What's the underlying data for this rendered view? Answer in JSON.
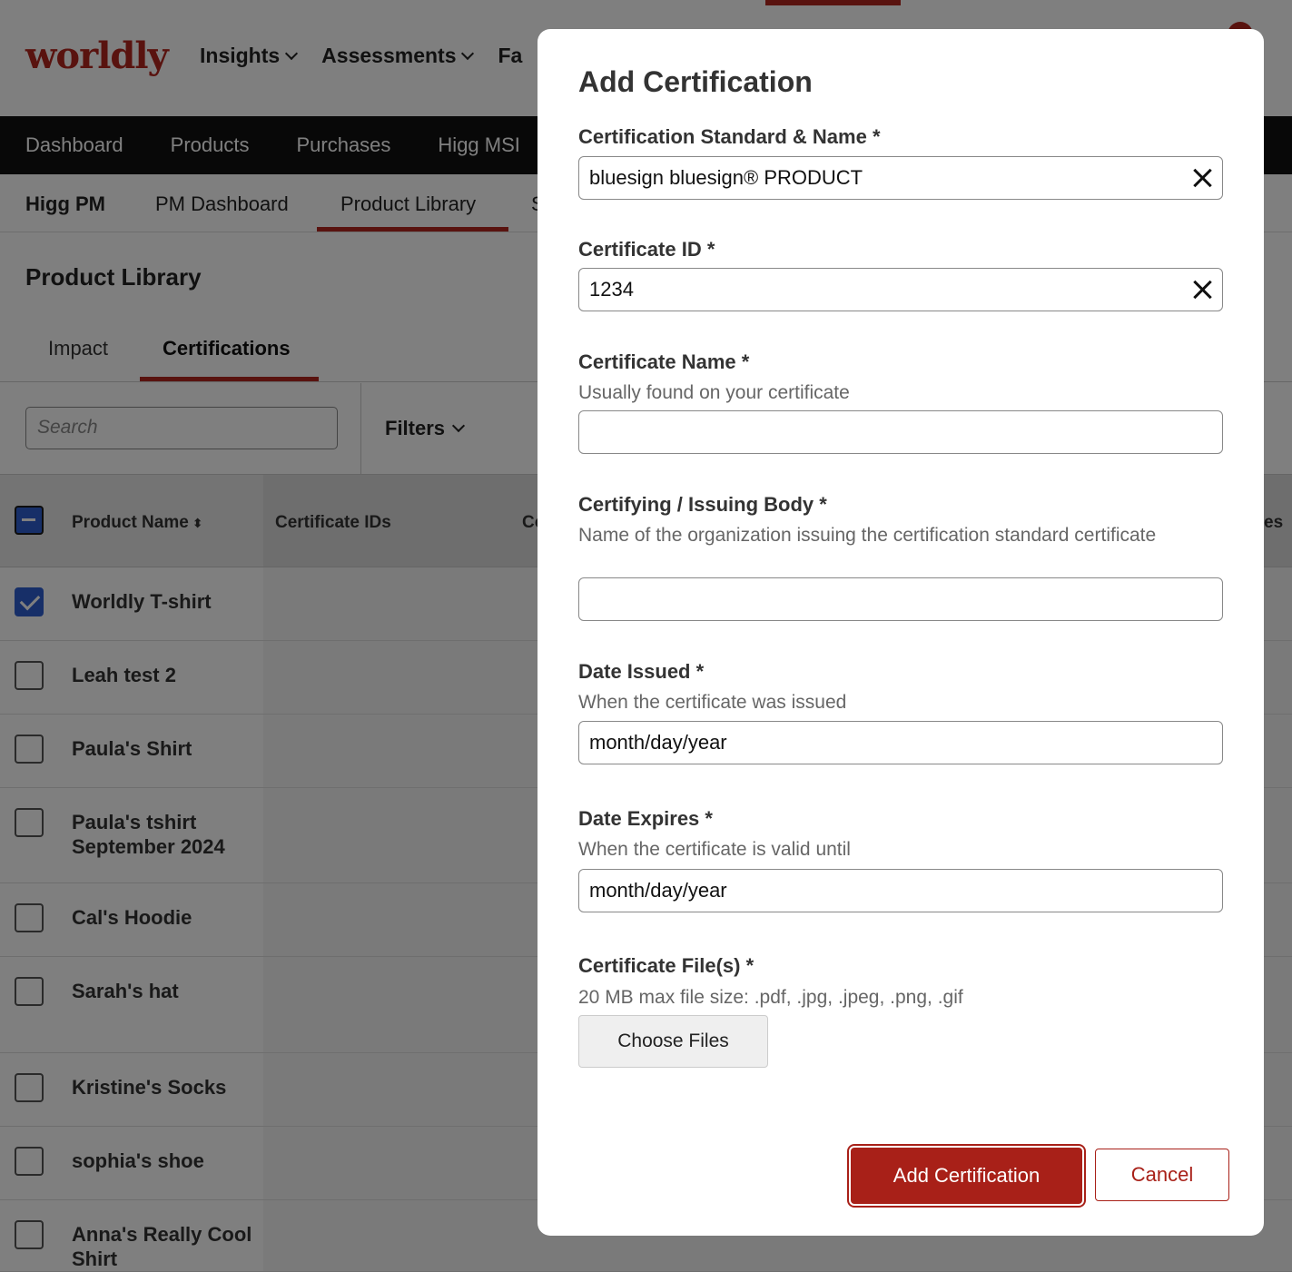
{
  "app": {
    "logo": "worldly",
    "top_nav": [
      "Insights",
      "Assessments",
      "Fa"
    ],
    "main_nav": [
      "Dashboard",
      "Products",
      "Purchases",
      "Higg MSI"
    ],
    "sub_nav": {
      "title": "Higg PM",
      "items": [
        "PM Dashboard",
        "Product Library",
        "S"
      ]
    },
    "page_title": "Product Library",
    "tabs": [
      "Impact",
      "Certifications"
    ],
    "search_placeholder": "Search",
    "filters_label": "Filters",
    "table": {
      "columns": [
        "Product Name",
        "Certificate IDs",
        "Co",
        "es"
      ],
      "rows": [
        {
          "name": "Worldly T-shirt",
          "checked": true
        },
        {
          "name": "Leah test 2",
          "checked": false
        },
        {
          "name": "Paula's Shirt",
          "checked": false
        },
        {
          "name": "Paula's tshirt September 2024",
          "checked": false
        },
        {
          "name": "Cal's Hoodie",
          "checked": false
        },
        {
          "name": "Sarah's hat",
          "checked": false
        },
        {
          "name": "Kristine's Socks",
          "checked": false
        },
        {
          "name": "sophia's shoe",
          "checked": false
        },
        {
          "name": "Anna's Really Cool Shirt",
          "checked": false
        }
      ]
    }
  },
  "modal": {
    "title": "Add Certification",
    "fields": {
      "standard": {
        "label": "Certification Standard & Name *",
        "value": "bluesign bluesign® PRODUCT"
      },
      "cert_id": {
        "label": "Certificate ID *",
        "value": "1234"
      },
      "cert_name": {
        "label": "Certificate Name *",
        "help": "Usually found on your certificate",
        "value": ""
      },
      "issuing_body": {
        "label": "Certifying / Issuing Body *",
        "help": "Name of the organization issuing the certification standard certificate",
        "value": ""
      },
      "date_issued": {
        "label": "Date Issued *",
        "help": "When the certificate was issued",
        "placeholder": "month/day/year"
      },
      "date_expires": {
        "label": "Date Expires *",
        "help": "When the certificate is valid until",
        "placeholder": "month/day/year"
      },
      "files": {
        "label": "Certificate File(s) *",
        "help": "20 MB max file size: .pdf, .jpg, .jpeg, .png, .gif",
        "button": "Choose Files"
      }
    },
    "submit_label": "Add Certification",
    "cancel_label": "Cancel"
  },
  "colors": {
    "brand": "#b3261e",
    "checkbox": "#2f5fd0"
  }
}
